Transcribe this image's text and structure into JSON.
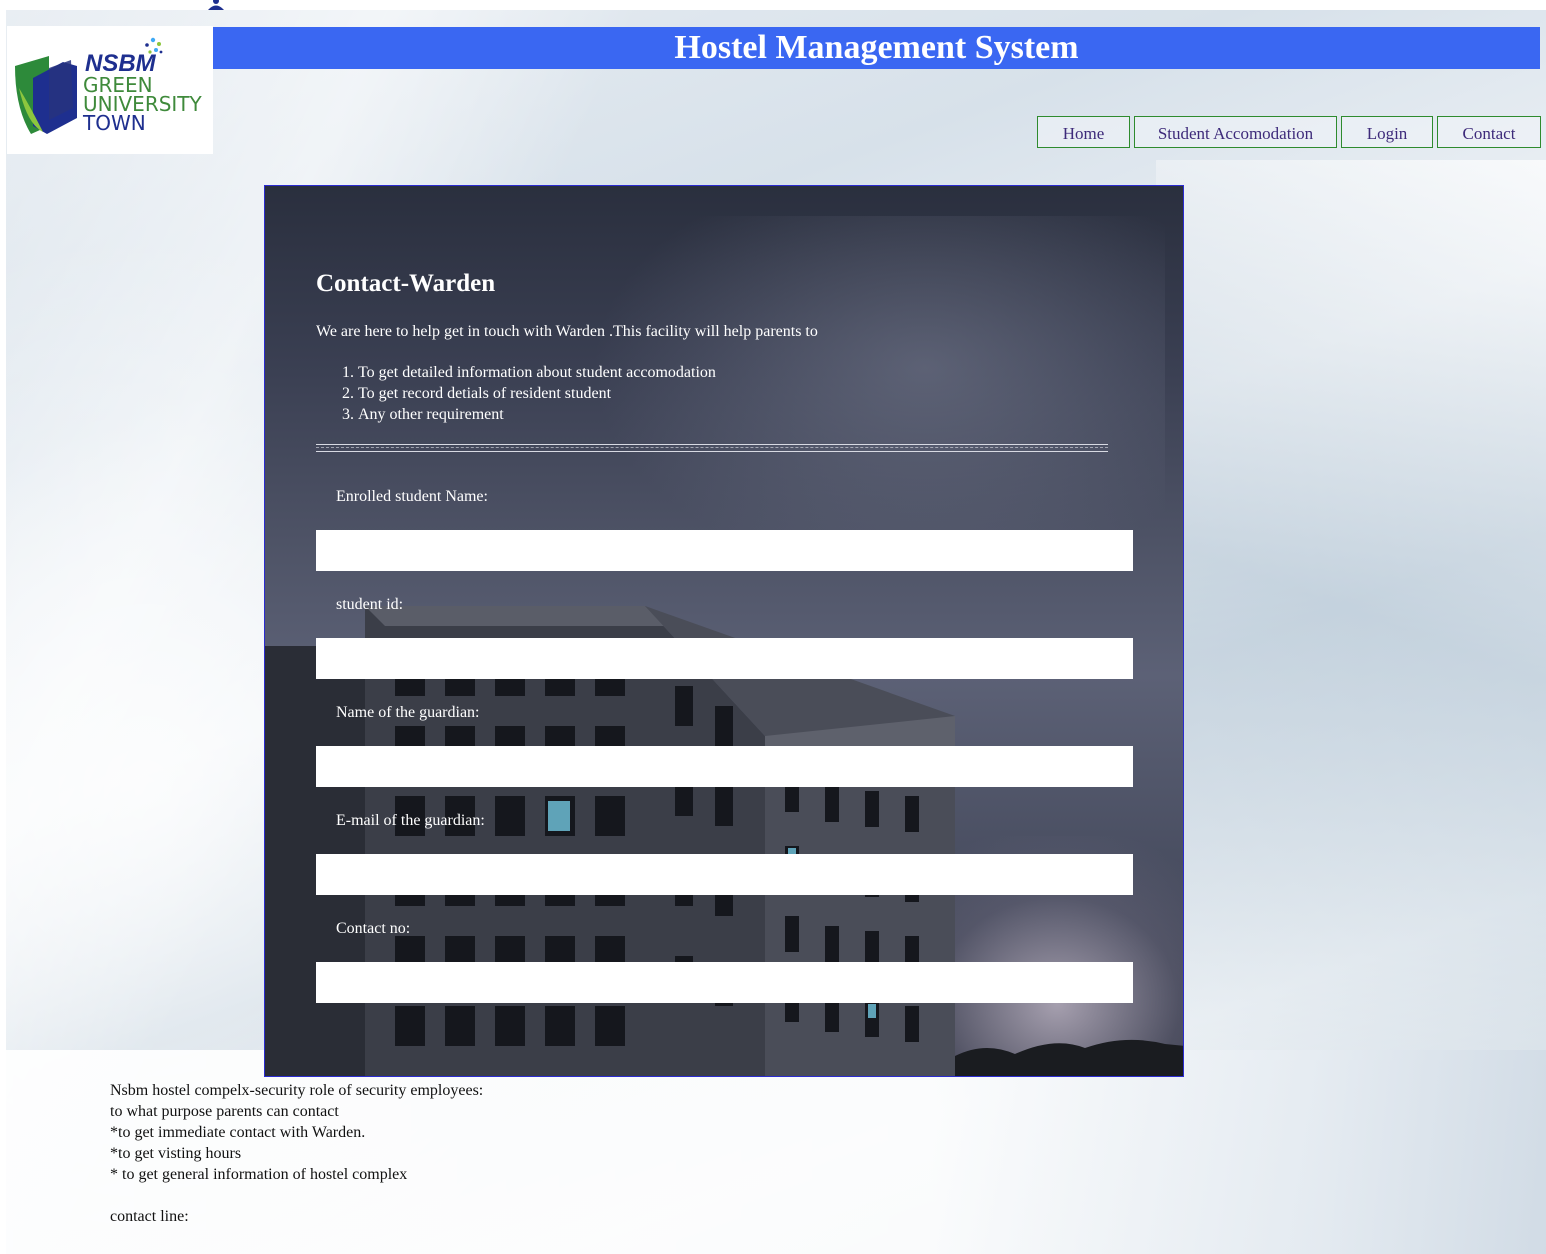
{
  "header": {
    "title": "Hostel Management System"
  },
  "logo": {
    "brand": "NSBM",
    "line1": "GREEN",
    "line2": "UNIVERSITY",
    "line3": "TOWN"
  },
  "nav": {
    "items": [
      {
        "label": "Home"
      },
      {
        "label": "Student Accomodation"
      },
      {
        "label": "Login"
      },
      {
        "label": "Contact"
      }
    ]
  },
  "form": {
    "heading": "Contact-Warden",
    "intro": "We are here to help get in touch with Warden .This facility will help parents to",
    "list": [
      "To get detailed information about student accomodation",
      "To get record detials of resident student",
      "Any other requirement"
    ],
    "fields": [
      {
        "label": "Enrolled student Name:",
        "value": ""
      },
      {
        "label": "student id:",
        "value": ""
      },
      {
        "label": "Name of the guardian:",
        "value": ""
      },
      {
        "label": "E-mail of the guardian:",
        "value": ""
      },
      {
        "label": "Contact no:",
        "value": ""
      }
    ]
  },
  "info": {
    "lines": [
      "Nsbm hostel compelx-security role of security employees:",
      "to what purpose parents can contact",
      "*to get immediate contact with Warden.",
      "*to get visting hours",
      "* to get general information of hostel complex"
    ],
    "contact_line": "contact line:"
  },
  "colors": {
    "header_bar": "#3a67f2",
    "nav_border": "#2e8b2e",
    "nav_text": "#3d2a7a",
    "panel_border": "#2b2bd0"
  }
}
